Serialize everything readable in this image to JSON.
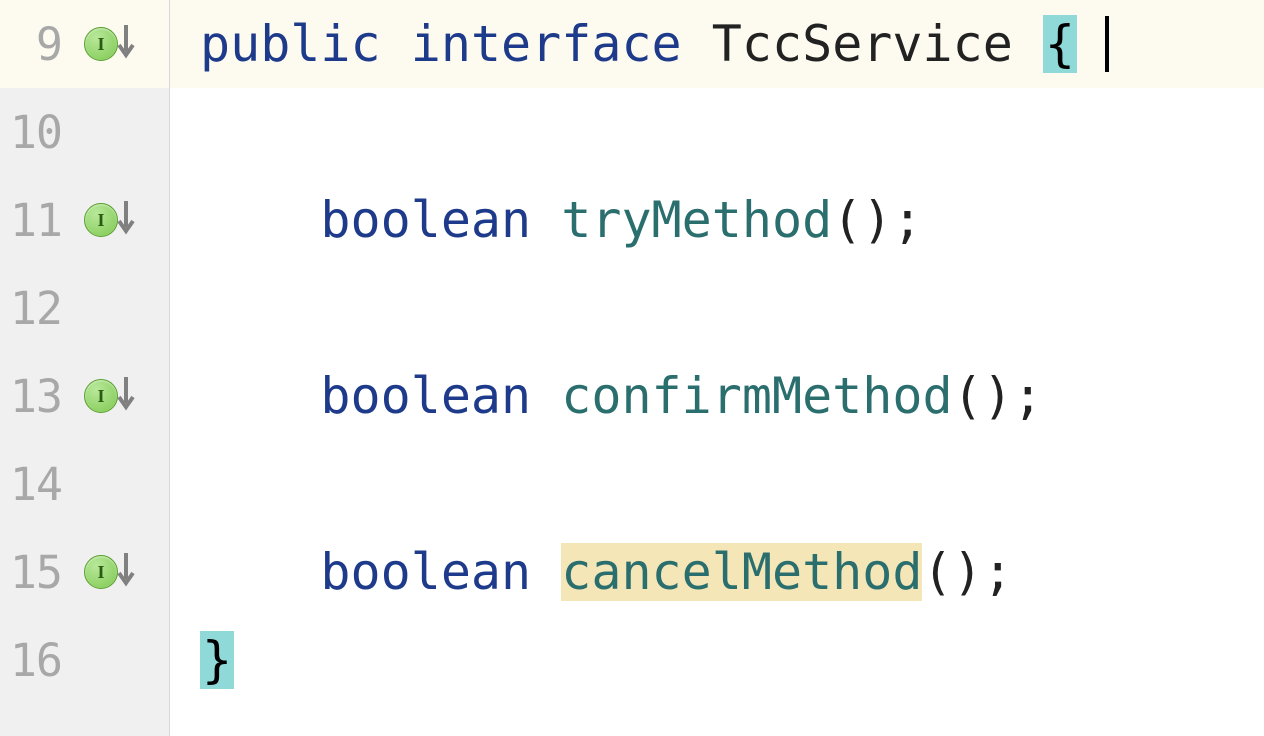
{
  "lines": [
    {
      "num": "9",
      "hasMarker": true,
      "current": true
    },
    {
      "num": "10",
      "hasMarker": false,
      "current": false
    },
    {
      "num": "11",
      "hasMarker": true,
      "current": false
    },
    {
      "num": "12",
      "hasMarker": false,
      "current": false
    },
    {
      "num": "13",
      "hasMarker": true,
      "current": false
    },
    {
      "num": "14",
      "hasMarker": false,
      "current": false
    },
    {
      "num": "15",
      "hasMarker": true,
      "current": false
    },
    {
      "num": "16",
      "hasMarker": false,
      "current": false
    }
  ],
  "markerLetter": "I",
  "code": {
    "line9": {
      "kw1": "public",
      "kw2": "interface",
      "className": "TccService",
      "brace": "{"
    },
    "line11": {
      "type": "boolean",
      "method": "tryMethod",
      "after": "();"
    },
    "line13": {
      "type": "boolean",
      "method": "confirmMethod",
      "after": "();"
    },
    "line15": {
      "type": "boolean",
      "method": "cancelMethod",
      "after": "();"
    },
    "line16": {
      "brace": "}"
    }
  }
}
